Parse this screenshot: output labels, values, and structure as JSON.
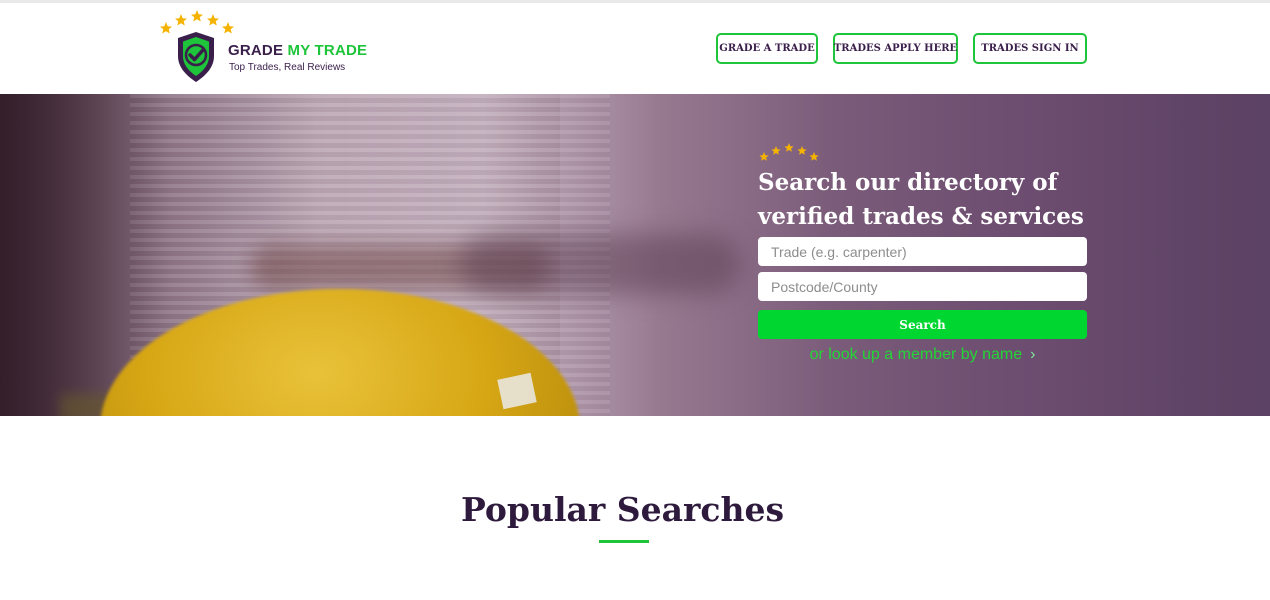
{
  "brand": {
    "name_part1": "GRADE ",
    "name_part2": "MY TRADE",
    "tagline": "Top Trades, Real Reviews",
    "colors": {
      "primary": "#3a1f4b",
      "accent": "#1ec43a",
      "star": "#f5b301"
    }
  },
  "nav": [
    {
      "label": "GRADE A TRADE"
    },
    {
      "label": "TRADES APPLY HERE"
    },
    {
      "label": "TRADES SIGN IN"
    }
  ],
  "hero": {
    "headline_line1": "Search our directory of",
    "headline_line2": "verified trades & services",
    "trade_placeholder": "Trade (e.g. carpenter)",
    "postcode_placeholder": "Postcode/County",
    "search_label": "Search",
    "lookup_text": "or look up a member by name",
    "lookup_chevron": "›",
    "icons": [
      "star-icon",
      "shield-check-icon",
      "chevron-right-icon"
    ]
  },
  "popular": {
    "title": "Popular Searches"
  }
}
